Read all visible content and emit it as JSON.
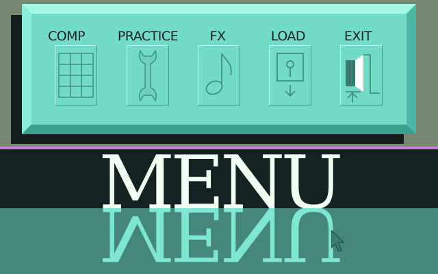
{
  "menu": {
    "items": [
      {
        "label": "COMP",
        "icon": "grid-icon"
      },
      {
        "label": "PRACTICE",
        "icon": "wrench-icon"
      },
      {
        "label": "FX",
        "icon": "music-note-icon"
      },
      {
        "label": "LOAD",
        "icon": "load-disk-icon"
      },
      {
        "label": "EXIT",
        "icon": "exit-door-icon"
      }
    ]
  },
  "title": {
    "text": "MENU",
    "reflection": "MENU"
  },
  "colors": {
    "panel_face": "#72dcc8",
    "panel_light": "#9cf6e4",
    "panel_dark": "#3fa696",
    "title_band": "#132323",
    "floor": "#45867a",
    "divider": "#cc80d8",
    "title_text": "#f2fff2",
    "reflection_text": "#7ee6d2"
  }
}
